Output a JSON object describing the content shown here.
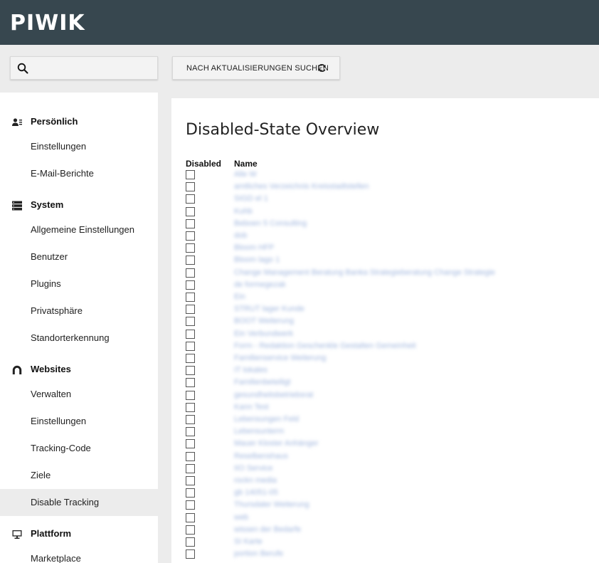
{
  "header": {
    "logo_text": "PIWIK"
  },
  "toolbar": {
    "search_placeholder": "",
    "search_value": "",
    "update_button_label": "NACH AKTUALISIERUNGEN SUCHEN"
  },
  "sidebar": {
    "sections": [
      {
        "label": "Persönlich",
        "icon": "user-settings-icon",
        "items": [
          "Einstellungen",
          "E-Mail-Berichte"
        ]
      },
      {
        "label": "System",
        "icon": "server-icon",
        "items": [
          "Allgemeine Einstellungen",
          "Benutzer",
          "Plugins",
          "Privatsphäre",
          "Standorterkennung"
        ]
      },
      {
        "label": "Websites",
        "icon": "website-icon",
        "items": [
          "Verwalten",
          "Einstellungen",
          "Tracking-Code",
          "Ziele",
          "Disable Tracking"
        ]
      },
      {
        "label": "Plattform",
        "icon": "monitor-icon",
        "items": [
          "Marketplace"
        ]
      }
    ],
    "active_item": "Disable Tracking"
  },
  "main": {
    "title": "Disabled-State Overview",
    "columns": [
      "Disabled",
      "Name"
    ],
    "rows": [
      {
        "disabled": false,
        "name": "Alle W"
      },
      {
        "disabled": false,
        "name": "amtliches Verzeichnis Kreisstadtstellen"
      },
      {
        "disabled": false,
        "name": "SIGD el 1"
      },
      {
        "disabled": false,
        "name": "Kuhb"
      },
      {
        "disabled": false,
        "name": "Beboen 5 Consulting"
      },
      {
        "disabled": false,
        "name": "dob"
      },
      {
        "disabled": false,
        "name": "Bloom HFP"
      },
      {
        "disabled": false,
        "name": "Bloom lago 1"
      },
      {
        "disabled": false,
        "name": "Change Management Beratung Banka Strategieberatung Change Strategie"
      },
      {
        "disabled": false,
        "name": "de formegezak"
      },
      {
        "disabled": false,
        "name": "Ein"
      },
      {
        "disabled": false,
        "name": "STRUT lager Kunde"
      },
      {
        "disabled": false,
        "name": "BOOT Weiterung"
      },
      {
        "disabled": false,
        "name": "Ein Verbundwerk"
      },
      {
        "disabled": false,
        "name": "Form - Redaktion Geschenkle Gestalten Gemeinheit"
      },
      {
        "disabled": false,
        "name": "Familienservice Weiterung"
      },
      {
        "disabled": false,
        "name": "IT lokales"
      },
      {
        "disabled": false,
        "name": "Familienbeteiligt"
      },
      {
        "disabled": false,
        "name": "gesundheitsbetriebsrat"
      },
      {
        "disabled": false,
        "name": "Kann Test"
      },
      {
        "disabled": false,
        "name": "Lebensungen Feld"
      },
      {
        "disabled": false,
        "name": "Lebensunterm"
      },
      {
        "disabled": false,
        "name": "Mauer Kloster Anhänger"
      },
      {
        "disabled": false,
        "name": "Reselbenshaus"
      },
      {
        "disabled": false,
        "name": "IIO Service"
      },
      {
        "disabled": false,
        "name": "rockn media"
      },
      {
        "disabled": false,
        "name": "gb 14051-05"
      },
      {
        "disabled": false,
        "name": "Thursdaler Weiterung"
      },
      {
        "disabled": false,
        "name": "web"
      },
      {
        "disabled": false,
        "name": "wissen der Bedarfe"
      },
      {
        "disabled": false,
        "name": "SI Karte"
      },
      {
        "disabled": false,
        "name": "portion Berufe"
      }
    ]
  }
}
